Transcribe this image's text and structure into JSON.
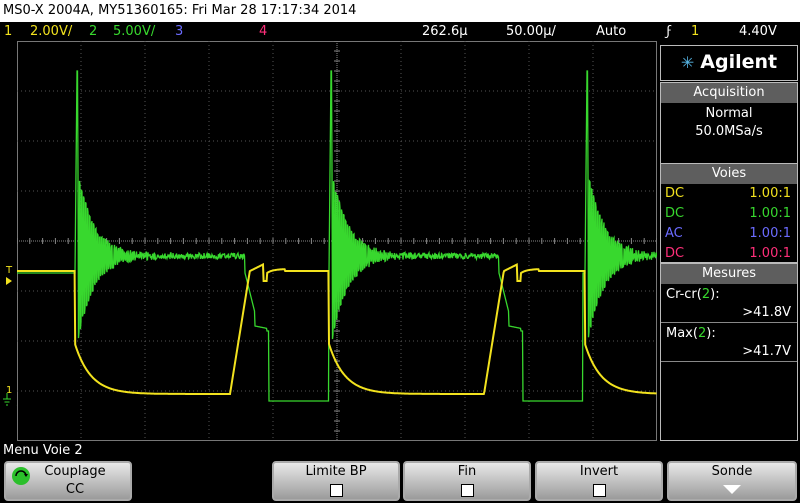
{
  "title": "MS0-X 2004A, MY51360165: Fri Mar 28 17:17:34 2014",
  "status": {
    "ch1_num": "1",
    "ch1_scale": "2.00V/",
    "ch2_num": "2",
    "ch2_scale": "5.00V/",
    "ch3_num": "3",
    "ch4_num": "4",
    "time_pos": "262.6µ",
    "time_scale": "50.00µ/",
    "trigger_mode": "Auto",
    "trig_icon": "ϝ",
    "trig_ch": "1",
    "trig_level": "4.40V"
  },
  "colors": {
    "ch1": "#f2e21e",
    "ch2": "#38d82e",
    "ch3": "#6b6bff",
    "ch4": "#ff2f7a",
    "header": "#5e5e5e"
  },
  "side": {
    "brand": "Agilent",
    "acq_header": "Acquisition",
    "acq_mode": "Normal",
    "acq_rate": "50.0MSa/s",
    "voies_header": "Voies",
    "probes": [
      {
        "coupling": "DC",
        "ratio": "1.00:1"
      },
      {
        "coupling": "DC",
        "ratio": "1.00:1"
      },
      {
        "coupling": "AC",
        "ratio": "1.00:1"
      },
      {
        "coupling": "DC",
        "ratio": "1.00:1"
      }
    ],
    "mes_header": "Mesures",
    "meas": [
      {
        "label": "Cr-cr",
        "ch": "2",
        "value": ">41.8V"
      },
      {
        "label": "Max",
        "ch": "2",
        "value": ">41.7V"
      }
    ]
  },
  "markers": {
    "trig": "T",
    "ch1": "1",
    "ch2": "2"
  },
  "menu_label": "Menu Voie 2",
  "softkeys": {
    "couplage_label": "Couplage",
    "couplage_value": "CC",
    "limite_label": "Limite BP",
    "fin_label": "Fin",
    "invert_label": "Invert",
    "sonde_label": "Sonde"
  }
}
